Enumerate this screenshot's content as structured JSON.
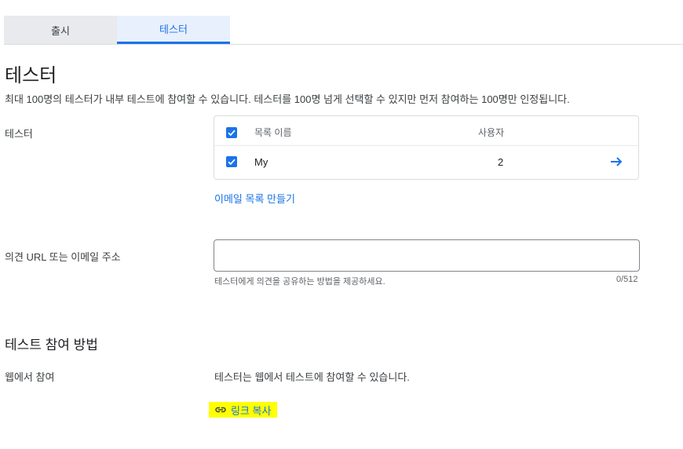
{
  "tabs": [
    {
      "label": "출시"
    },
    {
      "label": "테스터"
    }
  ],
  "heading": "테스터",
  "description": "최대 100명의 테스터가 내부 테스트에 참여할 수 있습니다. 테스터를 100명 넘게 선택할 수 있지만 먼저 참여하는 100명만 인정됩니다.",
  "testers_section": {
    "label": "테스터",
    "columns": {
      "name": "목록 이름",
      "users": "사용자"
    },
    "rows": [
      {
        "name": "My",
        "users": "2",
        "checked": true
      }
    ],
    "create_list_link": "이메일 목록 만들기"
  },
  "feedback": {
    "label": "의견 URL 또는 이메일 주소",
    "value": "",
    "placeholder": "",
    "helper": "테스터에게 의견을 공유하는 방법을 제공하세요.",
    "counter": "0/512"
  },
  "how_to_join": {
    "heading": "테스트 참여 방법",
    "web_label": "웹에서 참여",
    "web_text": "테스터는 웹에서 테스트에 참여할 수 있습니다.",
    "copy_link_label": "링크 복사"
  },
  "colors": {
    "accent": "#1a73e8",
    "highlight": "#ffff00"
  },
  "icons": {
    "checkbox": "checkbox-checked-icon",
    "row_arrow": "arrow-right-icon",
    "link": "link-icon"
  }
}
